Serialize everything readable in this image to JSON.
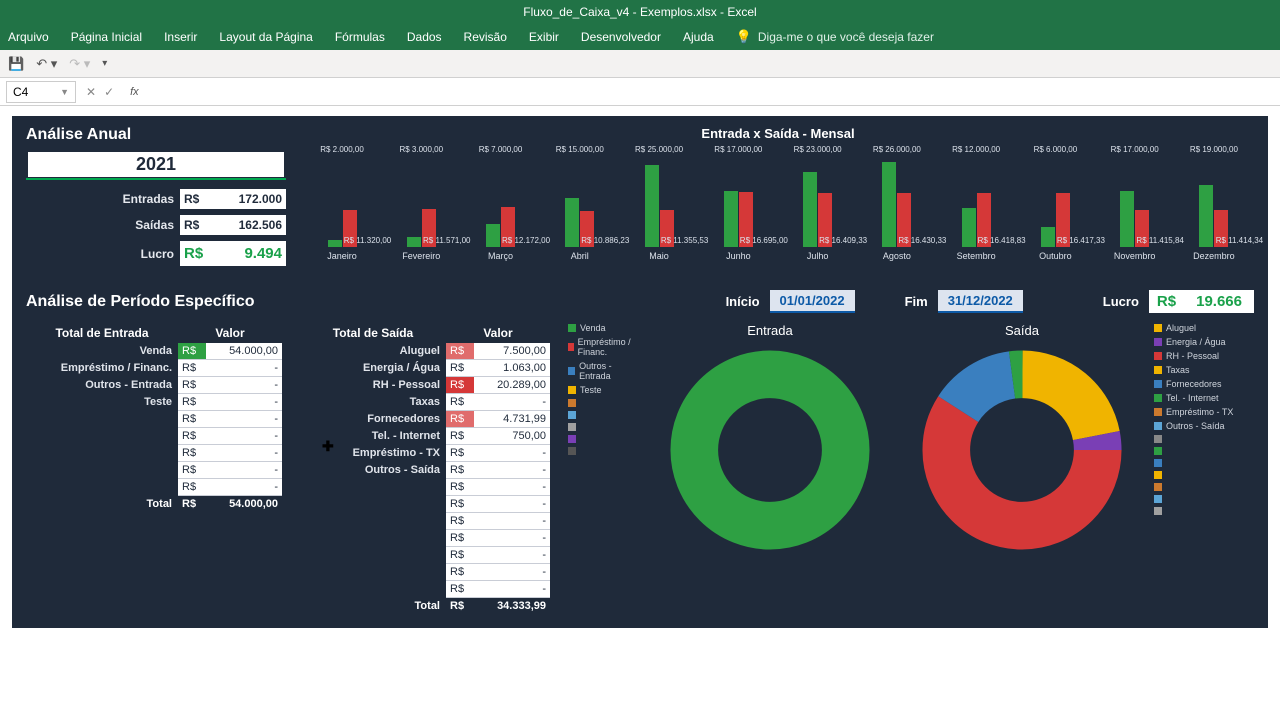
{
  "app": {
    "title": "Fluxo_de_Caixa_v4 - Exemplos.xlsx - Excel"
  },
  "ribbon": {
    "tabs": [
      "Arquivo",
      "Página Inicial",
      "Inserir",
      "Layout da Página",
      "Fórmulas",
      "Dados",
      "Revisão",
      "Exibir",
      "Desenvolvedor",
      "Ajuda"
    ],
    "tell": "Diga-me o que você deseja fazer"
  },
  "namebox": "C4",
  "dashboard": {
    "annual_title": "Análise Anual",
    "year": "2021",
    "entradas_label": "Entradas",
    "entradas_cur": "R$",
    "entradas_val": "172.000",
    "saidas_label": "Saídas",
    "saidas_cur": "R$",
    "saidas_val": "162.506",
    "lucro_label": "Lucro",
    "lucro_cur": "R$",
    "lucro_val": "9.494",
    "chart_title": "Entrada x Saída - Mensal"
  },
  "period": {
    "title": "Análise de Período Específico",
    "inicio_label": "Início",
    "inicio": "01/01/2022",
    "fim_label": "Fim",
    "fim": "31/12/2022",
    "lucro_label": "Lucro",
    "lucro_cur": "R$",
    "lucro_val": "19.666"
  },
  "tbl_entrada": {
    "h1": "Total de Entrada",
    "h2": "Valor",
    "rows": [
      {
        "label": "Venda",
        "cur": "R$",
        "val": "54.000,00",
        "cls": "hl"
      },
      {
        "label": "Empréstimo / Financ.",
        "cur": "R$",
        "val": "-"
      },
      {
        "label": "Outros - Entrada",
        "cur": "R$",
        "val": "-"
      },
      {
        "label": "Teste",
        "cur": "R$",
        "val": "-"
      },
      {
        "label": "",
        "cur": "R$",
        "val": "-"
      },
      {
        "label": "",
        "cur": "R$",
        "val": "-"
      },
      {
        "label": "",
        "cur": "R$",
        "val": "-"
      },
      {
        "label": "",
        "cur": "R$",
        "val": "-"
      },
      {
        "label": "",
        "cur": "R$",
        "val": "-"
      }
    ],
    "total_label": "Total",
    "total_cur": "R$",
    "total_val": "54.000,00"
  },
  "tbl_saida": {
    "h1": "Total de Saída",
    "h2": "Valor",
    "rows": [
      {
        "label": "Aluguel",
        "cur": "R$",
        "val": "7.500,00",
        "cls": "red1"
      },
      {
        "label": "Energia / Água",
        "cur": "R$",
        "val": "1.063,00"
      },
      {
        "label": "RH - Pessoal",
        "cur": "R$",
        "val": "20.289,00",
        "cls": "red2"
      },
      {
        "label": "Taxas",
        "cur": "R$",
        "val": "-"
      },
      {
        "label": "Fornecedores",
        "cur": "R$",
        "val": "4.731,99",
        "cls": "red1"
      },
      {
        "label": "Tel. - Internet",
        "cur": "R$",
        "val": "750,00"
      },
      {
        "label": "Empréstimo - TX",
        "cur": "R$",
        "val": "-"
      },
      {
        "label": "Outros - Saída",
        "cur": "R$",
        "val": "-"
      },
      {
        "label": "",
        "cur": "R$",
        "val": "-"
      },
      {
        "label": "",
        "cur": "R$",
        "val": "-"
      },
      {
        "label": "",
        "cur": "R$",
        "val": "-"
      },
      {
        "label": "",
        "cur": "R$",
        "val": "-"
      },
      {
        "label": "",
        "cur": "R$",
        "val": "-"
      },
      {
        "label": "",
        "cur": "R$",
        "val": "-"
      },
      {
        "label": "",
        "cur": "R$",
        "val": "-"
      }
    ],
    "total_label": "Total",
    "total_cur": "R$",
    "total_val": "34.333,99"
  },
  "donut_entrada": {
    "title": "Entrada",
    "legend": [
      "Venda",
      "Empréstimo / Financ.",
      "Outros - Entrada",
      "Teste",
      "",
      "",
      "",
      "",
      ""
    ]
  },
  "donut_saida": {
    "title": "Saída",
    "legend": [
      "Aluguel",
      "Energia / Água",
      "RH - Pessoal",
      "Taxas",
      "Fornecedores",
      "Tel. - Internet",
      "Empréstimo - TX",
      "Outros - Saída",
      "",
      "",
      "",
      "",
      "",
      "",
      ""
    ]
  },
  "chart_data": {
    "type": "bar",
    "title": "Entrada x Saída - Mensal",
    "categories": [
      "Janeiro",
      "Fevereiro",
      "Março",
      "Abril",
      "Maio",
      "Junho",
      "Julho",
      "Agosto",
      "Setembro",
      "Outubro",
      "Novembro",
      "Dezembro"
    ],
    "series": [
      {
        "name": "Entrada",
        "values": [
          2000,
          3000,
          7000,
          15000,
          25000,
          17000,
          23000,
          26000,
          12000,
          6000,
          17000,
          19000
        ],
        "labels": [
          "R$ 2.000,00",
          "R$ 3.000,00",
          "R$ 7.000,00",
          "R$ 15.000,00",
          "R$ 25.000,00",
          "R$ 17.000,00",
          "R$ 23.000,00",
          "R$ 26.000,00",
          "R$ 12.000,00",
          "R$ 6.000,00",
          "R$ 17.000,00",
          "R$ 19.000,00"
        ]
      },
      {
        "name": "Saída",
        "values": [
          11320,
          11571,
          12172,
          10886.23,
          11355.53,
          16695,
          16409.33,
          16430.33,
          16418.83,
          16417.33,
          11415.84,
          11414.34
        ],
        "labels": [
          "R$ 11.320,00",
          "R$ 11.571,00",
          "R$ 12.172,00",
          "R$ 10.886,23",
          "R$ 11.355,53",
          "R$ 16.695,00",
          "R$ 16.409,33",
          "R$ 16.430,33",
          "R$ 16.418,83",
          "R$ 16.417,33",
          "R$ 11.415,84",
          "R$ 11.414,34"
        ]
      }
    ],
    "ylim": [
      0,
      26000
    ]
  }
}
